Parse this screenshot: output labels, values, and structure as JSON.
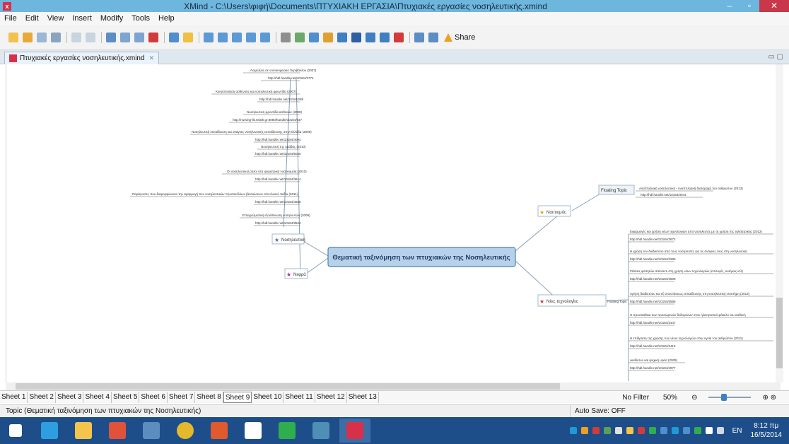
{
  "window": {
    "title": "XMind - C:\\Users\\φιφή\\Documents\\ΠΤΥΧΙΑΚΗ ΕΡΓΑΣΙΑ\\Πτυχιακές εργασίες νοσηλευτικής.xmind",
    "controls": [
      "–",
      "▫",
      "✕"
    ]
  },
  "menu": [
    "File",
    "Edit",
    "View",
    "Insert",
    "Modify",
    "Tools",
    "Help"
  ],
  "toolbar": {
    "share_label": "Share"
  },
  "doc_tab": {
    "label": "Πτυχιακές εργασίες νοσηλευτικής.xmind",
    "close": "✕",
    "window_controls": "▭ ▢"
  },
  "mindmap": {
    "central": "Θεματική ταξινόμηση των πτυχιακών της Νοσηλευτικής",
    "branches": [
      "Νοσηλευτική",
      "Νεφρά",
      "Ναυτιομός",
      "Νέες τεχνολογίες"
    ],
    "floating_top": "Floating Topic",
    "floating_top_items": [
      "Αναπτυξιακή νοσηλευτική - Αναπτυξιακή διαταραχή του ανθρώπου (2013)",
      "http://hdl.handle.net/10184/3043"
    ],
    "floating_tech": "Floating Topic",
    "left_items": [
      "Λοιμώξεις σε νοσοκομειακό περιβάλλον (2007)",
      "http://hdl.handle.net/10184/3774",
      "Κινητοποίηση ασθενούς και νοσηλευτική φροντίδα (2007)",
      "http://hdl.handle.net/10184/289",
      "Νοσηλευτική φροντίδα ασθενών (2008)",
      "http://nursing-lib.teiath.gr:8080/handle/10184/647",
      "Νοσηλευτική εκπαίδευση και ανάγκες νοσηλευτικής εκπαίδευσης στην Ελλάδα (2009)",
      "http://hdl.handle.net/10184/4094",
      "Νοσηλευτική της ομάδας (2010)",
      "http://hdl.handle.net/10184/5040",
      "Οι νοσηλευτικοί ρόλοι στα ψυχιατρικά νοσοκομεία (2010)",
      "http://hdl.handle.net/10184/3614",
      "Παράγοντες που διαμορφώνουν την εφαρμογή των νοσηλευτικών πρωτοκόλλων βελτιώσεων στο κλινικό πεδίο (2011)",
      "http://hdl.handle.net/10184/4855",
      "Επαγγελματική εξουθένωση νοσηλευτών (2008)",
      "http://hdl.handle.net/10184/3524"
    ],
    "right_items": [
      "Εφαρμογές και χρήση νέων τεχνολογιών από νοσηλευτές με τη χρήση της τηλεϊατρικής (2012)",
      "http://hdl.handle.net/10184/3672",
      "Η χρήση του διαδικτύου από τους νοσηλευτές για τις ανάγκες τους στη νοσηλευτική",
      "http://hdl.handle.net/10184/2280",
      "Στάσεις φοιτητών απέναντι στη χρήση νέων τεχνολογιών (επιλογές, ανάγκες κτλ)",
      "http://hdl.handle.net/10184/4509",
      "Χρήση διαδικτύου και εξ αποστάσεως εκπαίδευσης στη νοσηλευτική επιστήμη (2013)",
      "http://hdl.handle.net/10184/5568",
      "Η προσπαθεια των προσωρινών δεδομένων στον ηλεκτρονικό φάκελο του ασθενή",
      "http://hdl.handle.net/10184/2447",
      "Η επίδραση της χρήσης των νέων τεχνολογιών στην υγεία του ανθρώπου (2011)",
      "http://hdl.handle.net/10184/2413",
      "Διαδίκτυο και ψυχική υγεία (2009)",
      "http://hdl.handle.net/10184/4977"
    ]
  },
  "sheets": [
    "Sheet 1",
    "Sheet 2",
    "Sheet 3",
    "Sheet 4",
    "Sheet 5",
    "Sheet 6",
    "Sheet 7",
    "Sheet 8",
    "Sheet 9",
    "Sheet 10",
    "Sheet 11",
    "Sheet 12",
    "Sheet 13"
  ],
  "active_sheet": "Sheet 9",
  "filter": "No Filter",
  "zoom": "50%",
  "zoom_minus": "⊖",
  "zoom_plus": "⊕ ⊚",
  "status": {
    "topic": "Topic (Θεματική ταξινόμηση των πτυχιακών της Νοσηλευτικής)",
    "autosave": "Auto Save: OFF"
  },
  "tray": {
    "lang": "EN",
    "time": "8:12 πμ",
    "date": "16/5/2014"
  }
}
